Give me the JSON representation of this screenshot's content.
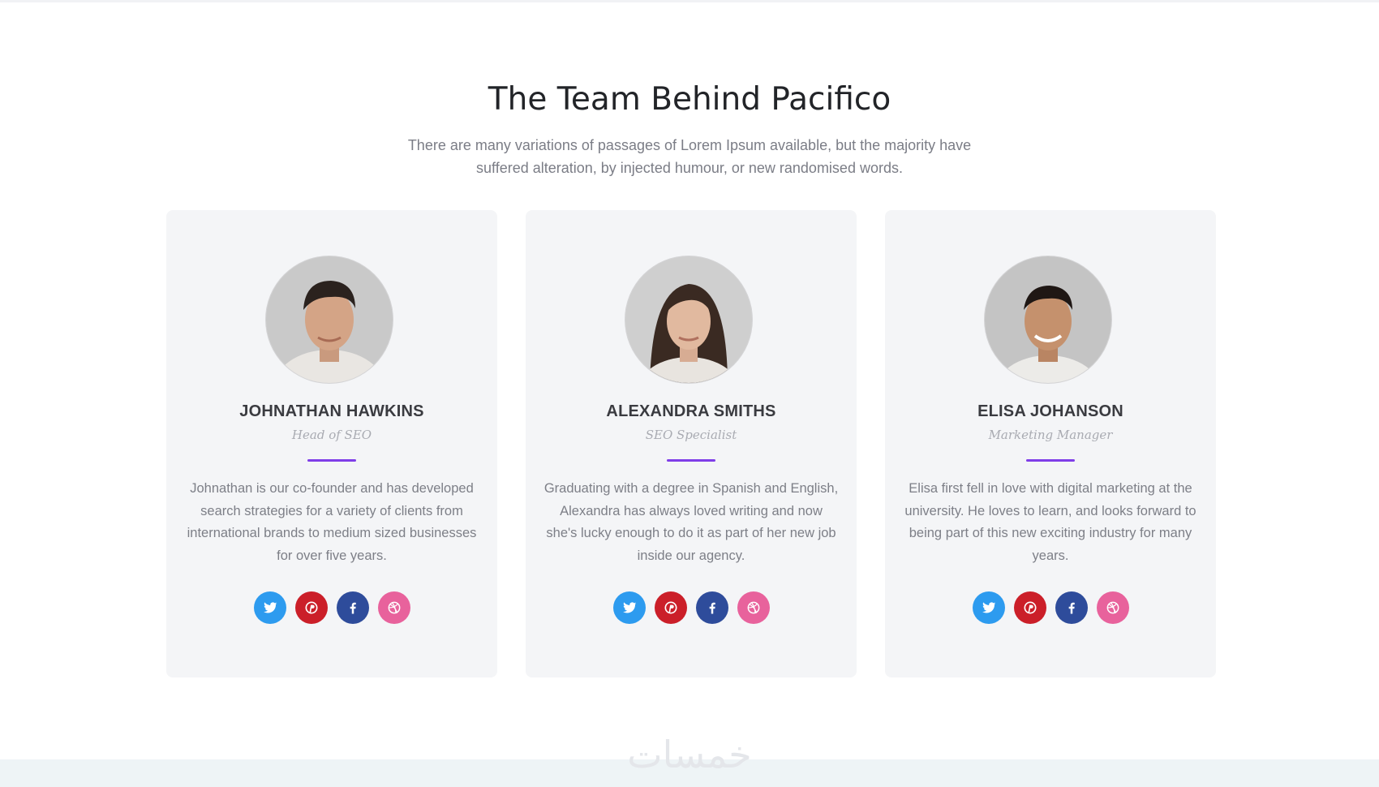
{
  "header": {
    "title": "The Team Behind Pacifico",
    "subtitle": "There are many variations of passages of Lorem Ipsum available, but the majority have suffered alteration, by injected humour, or new randomised words."
  },
  "colors": {
    "accent": "#7f3ee8",
    "twitter": "#2d9bef",
    "pinterest": "#cb1f29",
    "facebook": "#2e4c9b",
    "dribbble": "#e8629c",
    "card_background": "#f4f5f7"
  },
  "team": [
    {
      "name": "JOHNATHAN HAWKINS",
      "role": "Head of SEO",
      "bio": "Johnathan is our co-founder and has developed search strategies for a variety of clients from international brands to medium sized businesses for over five years.",
      "avatar_icon": "man-portrait-photo"
    },
    {
      "name": "ALEXANDRA SMITHS",
      "role": "SEO Specialist",
      "bio": "Graduating with a degree in Spanish and English, Alexandra has always loved writing and now she's lucky enough to do it as part of her new job inside our agency.",
      "avatar_icon": "woman-portrait-photo"
    },
    {
      "name": "ELISA JOHANSON",
      "role": "Marketing Manager",
      "bio": "Elisa first fell in love with digital marketing at the university. He loves to learn, and looks forward to being part of this new exciting industry for many years.",
      "avatar_icon": "man-portrait-photo"
    }
  ],
  "social_icons": [
    "twitter-icon",
    "pinterest-icon",
    "facebook-icon",
    "dribbble-icon"
  ],
  "watermark": {
    "text": "خمسات"
  }
}
